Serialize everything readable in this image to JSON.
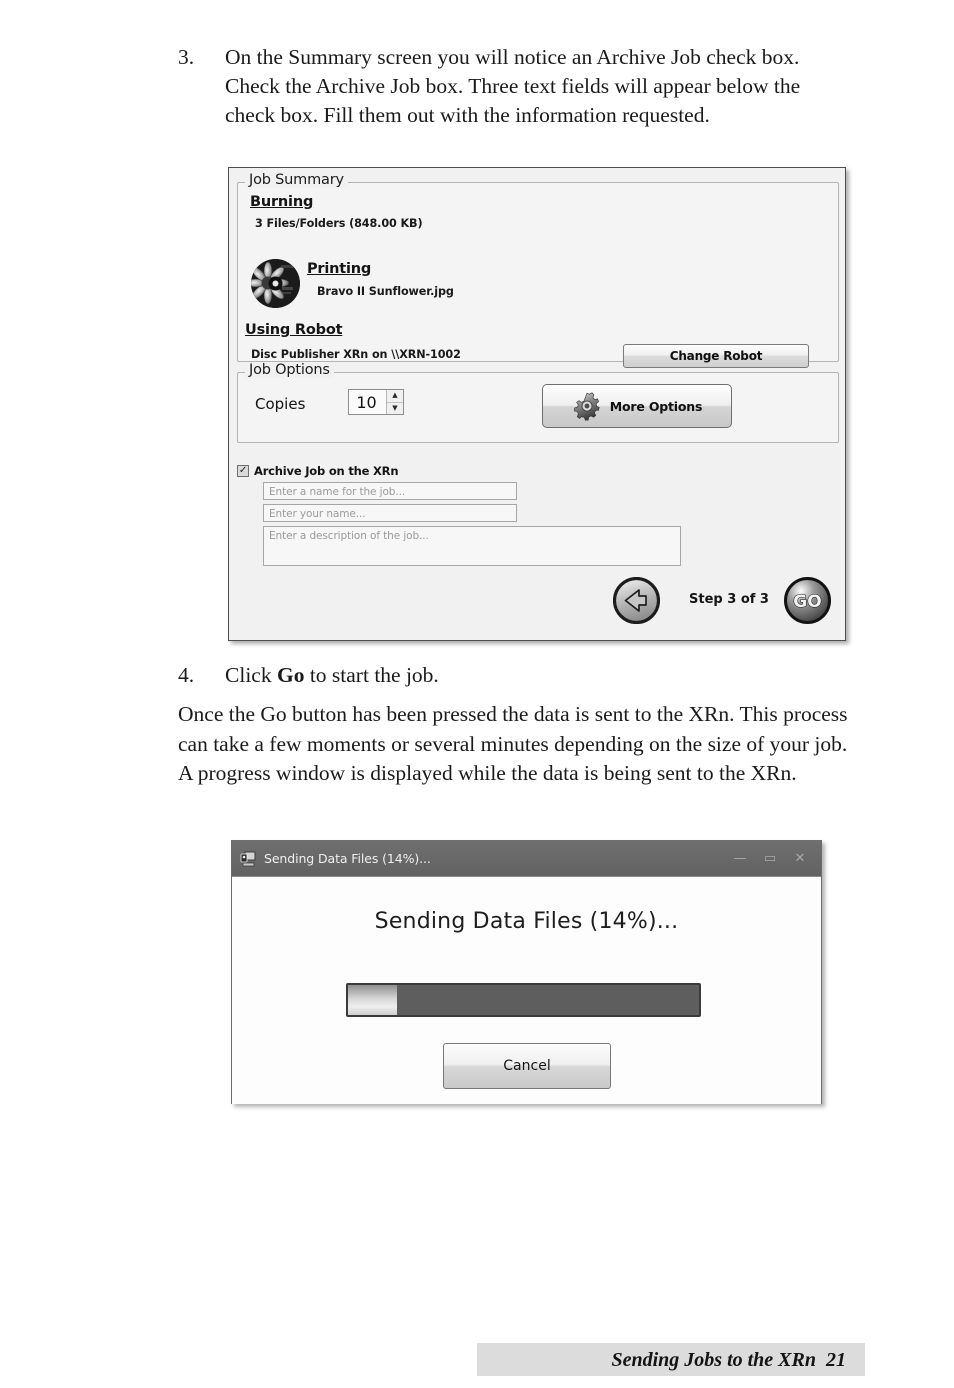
{
  "page": {
    "step3": {
      "number": "3.",
      "text": "On the Summary screen you will notice an Archive Job check box. Check the Archive Job box.  Three text fields will appear below the check box.  Fill them out with the information requested."
    },
    "step4": {
      "number": "4.",
      "text_before": "Click ",
      "bold": "Go",
      "text_after": " to start the job."
    },
    "paragraph": "Once the Go button has been pressed the data is sent to the XRn.  This process can take a few moments or several minutes depending on the size of your job.  A progress window is displayed while the data is being sent to the XRn.",
    "footer": {
      "title": "Sending Jobs to the XRn",
      "page_number": "21"
    }
  },
  "summary_dialog": {
    "job_summary": {
      "group_label": "Job Summary",
      "burning_heading": "Burning",
      "burning_detail": "3 Files/Folders (848.00 KB)",
      "printing_heading": "Printing",
      "printing_detail": "Bravo II Sunflower.jpg",
      "thumbnail_icon": "sunflower-disc-thumbnail",
      "robot_heading": "Using Robot",
      "robot_detail": "Disc Publisher XRn  on \\\\XRN-1002",
      "change_robot_label": "Change Robot"
    },
    "job_options": {
      "group_label": "Job Options",
      "copies_label": "Copies",
      "copies_value": "10",
      "spinner_up": "▲",
      "spinner_down": "▼",
      "more_options_label": "More Options",
      "more_options_icon": "gear-icon"
    },
    "archive": {
      "checkbox_label": "Archive Job on the XRn",
      "checkbox_checked": true,
      "checkmark": "✓",
      "job_name_placeholder": "Enter a name for the job...",
      "job_name_value": "",
      "your_name_placeholder": "Enter your name...",
      "your_name_value": "",
      "description_placeholder": "Enter a description of the job...",
      "description_value": ""
    },
    "navigation": {
      "back_icon": "back-arrow-icon",
      "step_label": "Step 3 of 3",
      "go_label": "GO",
      "go_icon": "go-button-icon"
    }
  },
  "progress_dialog": {
    "title_icon": "application-icon",
    "title": "Sending Data Files (14%)...",
    "minimize_glyph": "—",
    "maximize_glyph": "▭",
    "close_glyph": "✕",
    "heading": "Sending Data Files (14%)...",
    "progress_percent": 14,
    "cancel_label": "Cancel"
  }
}
